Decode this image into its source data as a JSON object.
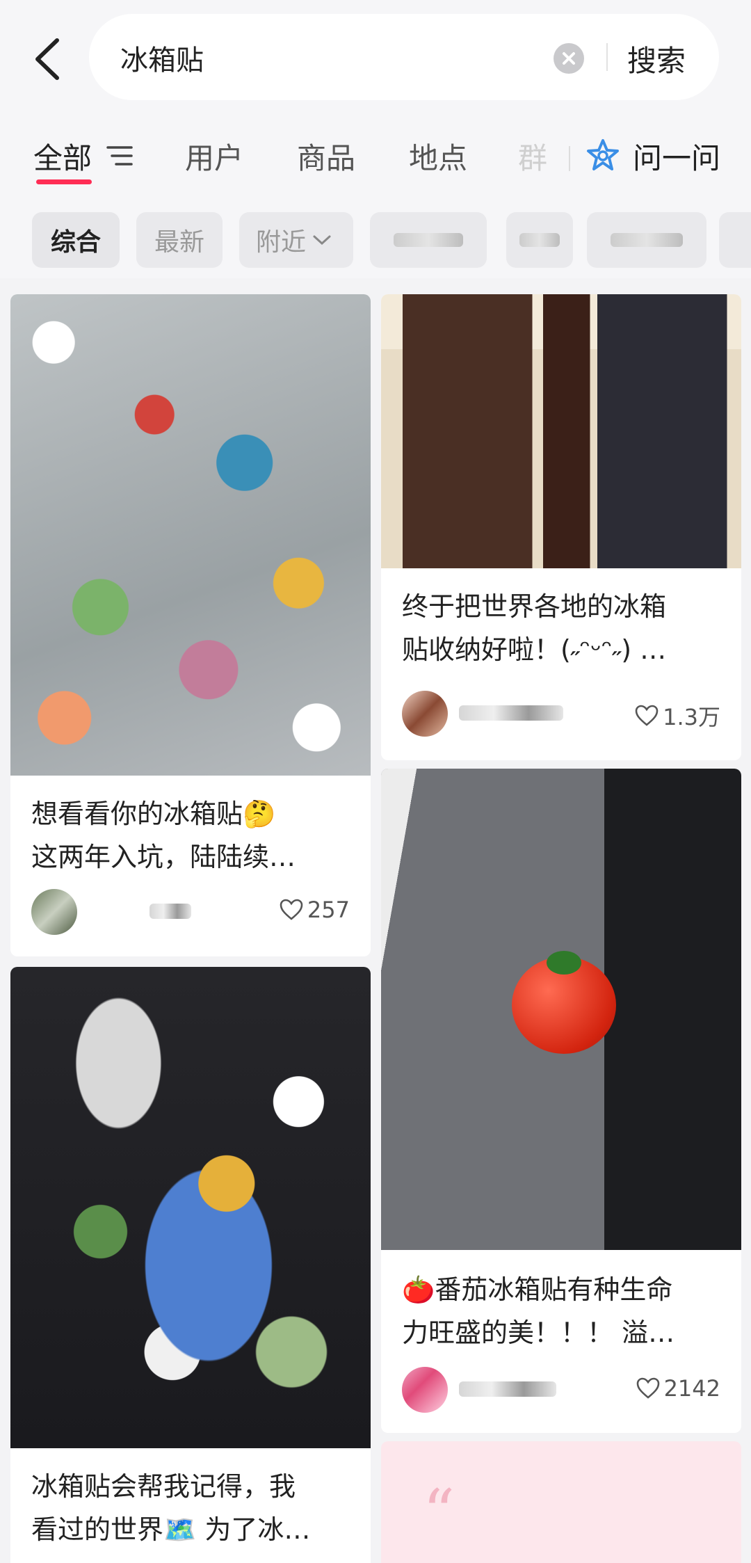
{
  "search": {
    "query": "冰箱贴",
    "button_label": "搜索"
  },
  "tabs": {
    "items": [
      "全部",
      "用户",
      "商品",
      "地点"
    ],
    "faded_item": "群",
    "ask_label": "问一问"
  },
  "chips": [
    "综合",
    "最新",
    "附近"
  ],
  "feed": {
    "cards": [
      {
        "title_line1": "想看看你的冰箱贴🤔",
        "title_line2": "这两年入坑，陆陆续…",
        "likes": "257"
      },
      {
        "title_line1": "终于把世界各地的冰箱",
        "title_line2": "贴收纳好啦！(˶ᵔᵕᵔ˶) …",
        "likes": "1.3万"
      },
      {
        "title_line1": "🍅番茄冰箱贴有种生命",
        "title_line2": "力旺盛的美！！！ 溢…",
        "likes": "2142"
      },
      {
        "title_line1": "冰箱贴会帮我记得，我",
        "title_line2": "看过的世界🗺️ 为了冰…"
      }
    ]
  },
  "colors": {
    "accent": "#ff2d55",
    "ask_icon": "#3a8ee6"
  }
}
